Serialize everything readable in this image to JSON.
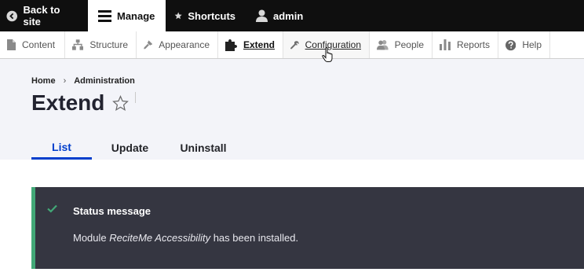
{
  "toolbar": {
    "back": "Back to site",
    "manage": "Manage",
    "shortcuts": "Shortcuts",
    "user": "admin"
  },
  "admin_menu": [
    "Content",
    "Structure",
    "Appearance",
    "Extend",
    "Configuration",
    "People",
    "Reports",
    "Help"
  ],
  "breadcrumb": [
    "Home",
    "Administration"
  ],
  "breadcrumb_separator": "›",
  "page": {
    "title": "Extend"
  },
  "tabs": [
    "List",
    "Update",
    "Uninstall"
  ],
  "status": {
    "heading": "Status message",
    "prefix": "Module ",
    "module_name": "ReciteMe Accessibility",
    "suffix": " has been installed."
  },
  "colors": {
    "accent": "#003ecc",
    "status_bg": "#353641",
    "status_border": "#42a877",
    "toolbar_bg": "#0f0f0f"
  }
}
